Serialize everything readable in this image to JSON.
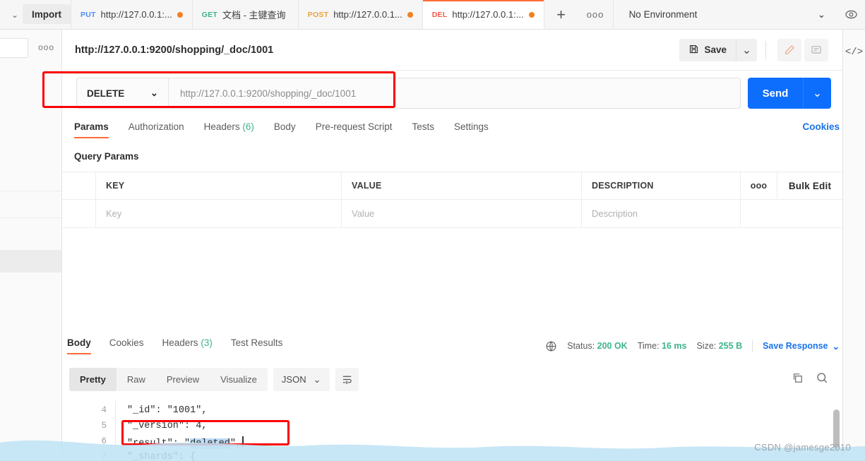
{
  "topbar": {
    "import_label": "Import",
    "left_caret": "⌄",
    "tabs": [
      {
        "method": "PUT",
        "method_class": "put",
        "name": "http://127.0.0.1:...",
        "unsaved": true,
        "active": false
      },
      {
        "method": "GET",
        "method_class": "get",
        "name": "文档 - 主键查询",
        "unsaved": false,
        "active": false
      },
      {
        "method": "POST",
        "method_class": "post",
        "name": "http://127.0.0.1...",
        "unsaved": true,
        "active": false
      },
      {
        "method": "DEL",
        "method_class": "del",
        "name": "http://127.0.0.1:...",
        "unsaved": true,
        "active": true
      }
    ],
    "new_tab_label": "+",
    "tab_options_label": "ooo",
    "environment": "No Environment",
    "env_caret": "⌄",
    "eye_icon": "eye-icon"
  },
  "sidebar": {
    "options_label": "ooo"
  },
  "request_header": {
    "title": "http://127.0.0.1:9200/shopping/_doc/1001",
    "save_label": "Save",
    "save_caret": "⌄",
    "edit_icon": "pencil-icon",
    "comment_icon": "comment-icon"
  },
  "rail": {
    "code_icon": "</>"
  },
  "urlbar": {
    "method": "DELETE",
    "method_caret": "⌄",
    "url_placeholder": "http://127.0.0.1:9200/shopping/_doc/1001",
    "send_label": "Send",
    "send_caret": "⌄"
  },
  "request_tabs": {
    "items": [
      {
        "label": "Params",
        "count": "",
        "active": true
      },
      {
        "label": "Authorization",
        "count": "",
        "active": false
      },
      {
        "label": "Headers",
        "count": "(6)",
        "active": false
      },
      {
        "label": "Body",
        "count": "",
        "active": false
      },
      {
        "label": "Pre-request Script",
        "count": "",
        "active": false
      },
      {
        "label": "Tests",
        "count": "",
        "active": false
      },
      {
        "label": "Settings",
        "count": "",
        "active": false
      }
    ],
    "cookies_label": "Cookies"
  },
  "params": {
    "section_label": "Query Params",
    "headers": {
      "key": "KEY",
      "value": "VALUE",
      "description": "DESCRIPTION",
      "options": "ooo",
      "bulk_edit": "Bulk Edit"
    },
    "rows": [
      {
        "key": "Key",
        "value": "Value",
        "description": "Description"
      }
    ]
  },
  "response": {
    "tabs": [
      {
        "label": "Body",
        "count": "",
        "active": true
      },
      {
        "label": "Cookies",
        "count": "",
        "active": false
      },
      {
        "label": "Headers",
        "count": "(3)",
        "active": false
      },
      {
        "label": "Test Results",
        "count": "",
        "active": false
      }
    ],
    "globe_icon": "globe-icon",
    "status_label": "Status:",
    "status_value": "200 OK",
    "time_label": "Time:",
    "time_value": "16 ms",
    "size_label": "Size:",
    "size_value": "255 B",
    "save_response_label": "Save Response",
    "save_response_caret": "⌄",
    "format_tabs": [
      {
        "label": "Pretty",
        "active": true
      },
      {
        "label": "Raw",
        "active": false
      },
      {
        "label": "Preview",
        "active": false
      },
      {
        "label": "Visualize",
        "active": false
      }
    ],
    "language": "JSON",
    "language_caret": "⌄",
    "wrap_icon": "text-wrap-icon",
    "copy_icon": "copy-icon",
    "search_icon": "search-icon",
    "code_lines": [
      {
        "num": "4",
        "text": "\"_id\": \"1001\","
      },
      {
        "num": "5",
        "text": "\"_version\": 4,"
      },
      {
        "num": "6",
        "text": "\"result\": \"deleted\","
      },
      {
        "num": "7",
        "text": "\"_shards\": {"
      }
    ],
    "highlighted_token": "deleted"
  },
  "watermark": "CSDN @jamesge2010",
  "colors": {
    "accent_orange": "#ff6c37",
    "send_blue": "#0d6efd",
    "link_blue": "#1a73e8",
    "status_green": "#3eb489",
    "annotation_red": "#fb0000",
    "highlight_blue": "#bcdcf7"
  }
}
